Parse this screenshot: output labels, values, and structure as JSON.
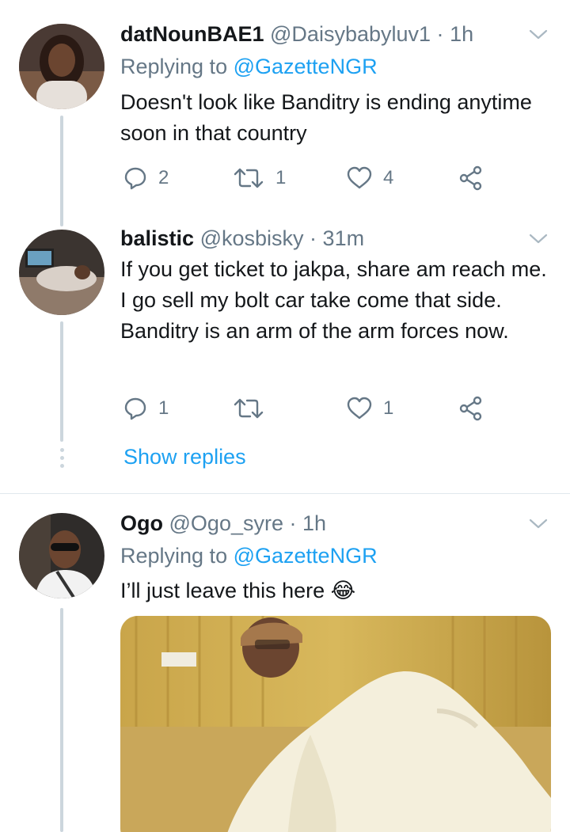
{
  "tweets": [
    {
      "name": "datNounBAE1",
      "handle": "@Daisybabyluv1",
      "time": "1h",
      "replying_prefix": "Replying to",
      "replying_to": "@GazetteNGR",
      "text": "Doesn't look like Banditry is ending anytime soon in that country",
      "replies": "2",
      "retweets": "1",
      "likes": "4"
    },
    {
      "name": "balistic",
      "handle": "@kosbisky",
      "time": "31m",
      "text": "If you get ticket to jakpa, share am reach me. I go sell my bolt car take come that side. Banditry is an arm of the arm forces now.",
      "replies": "1",
      "retweets": "",
      "likes": "1",
      "show_replies": "Show replies"
    },
    {
      "name": "Ogo",
      "handle": "@Ogo_syre",
      "time": "1h",
      "replying_prefix": "Replying to",
      "replying_to": "@GazetteNGR",
      "text": "I’ll just leave this here",
      "emoji": "😂"
    }
  ],
  "separator": "·",
  "colors": {
    "text": "#14171a",
    "secondary": "#657786",
    "link": "#1da1f2",
    "thread_line": "#ccd6dd"
  },
  "icons": [
    "reply-icon",
    "retweet-icon",
    "like-icon",
    "share-icon",
    "chevron-down-icon"
  ]
}
